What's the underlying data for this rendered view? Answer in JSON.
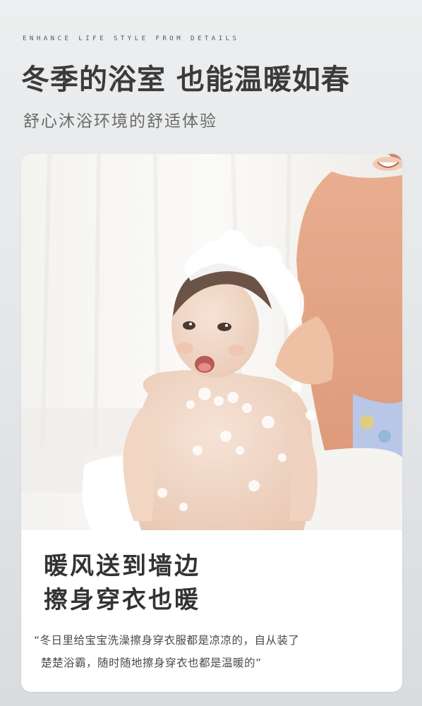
{
  "header": {
    "tagline": "ENHANCE LIFE STYLE FROM DETAILS",
    "headline": "冬季的浴室 也能温暖如春",
    "subheadline": "舒心沐浴环境的舒适体验"
  },
  "card": {
    "image": {
      "subject": "baby-bath-photo"
    },
    "title_lines": [
      "暖风送到墙边",
      "擦身穿衣也暖"
    ],
    "quote_lines": [
      "“冬日里给宝宝洗澡擦身穿衣服都是凉凉的，自从装了",
      "楚楚浴霸，随时随地擦身穿衣也都是温暖的”"
    ]
  },
  "colors": {
    "background": "#e6e8ea",
    "headline": "#3b3b3b",
    "subheadline": "#6a6a6a",
    "card": "#ffffff",
    "body_text": "#4a4a4a"
  }
}
